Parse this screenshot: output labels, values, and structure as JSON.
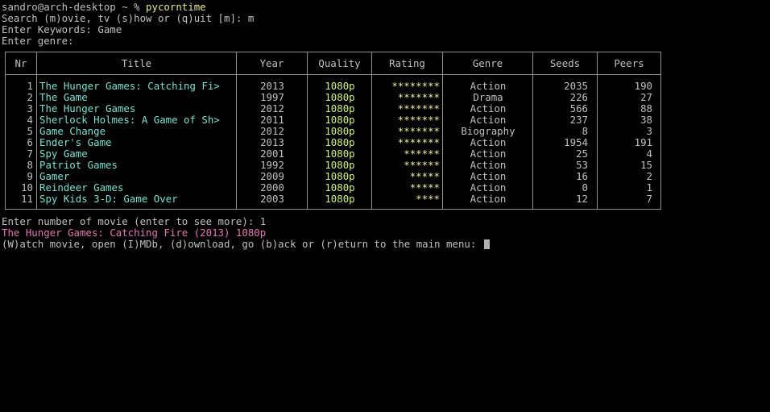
{
  "terminal": {
    "prompt_user_host": "sandro@arch-desktop ~ % ",
    "command": "pycorntime",
    "search_prompt": "Search (m)ovie, tv (s)how or (q)uit [m]: m",
    "keywords_prompt": "Enter Keywords: Game",
    "genre_prompt": "Enter genre:",
    "number_prompt": "Enter number of movie (enter to see more): 1",
    "selected_movie": "The Hunger Games: Catching Fire (2013) 1080p",
    "action_prompt": "(W)atch movie, open (I)MDb, (d)ownload, go (b)ack or (r)eturn to the main menu: "
  },
  "table": {
    "headers": {
      "nr": "Nr",
      "title": "Title",
      "year": "Year",
      "quality": "Quality",
      "rating": "Rating",
      "genre": "Genre",
      "seeds": "Seeds",
      "peers": "Peers"
    },
    "rows": [
      {
        "nr": "1",
        "title": "The Hunger Games: Catching Fi>",
        "year": "2013",
        "quality": "1080p",
        "rating": "********",
        "genre": "Action",
        "seeds": "2035",
        "peers": "190"
      },
      {
        "nr": "2",
        "title": "The Game",
        "year": "1997",
        "quality": "1080p",
        "rating": "*******",
        "genre": "Drama",
        "seeds": "226",
        "peers": "27"
      },
      {
        "nr": "3",
        "title": "The Hunger Games",
        "year": "2012",
        "quality": "1080p",
        "rating": "*******",
        "genre": "Action",
        "seeds": "566",
        "peers": "88"
      },
      {
        "nr": "4",
        "title": "Sherlock Holmes: A Game of Sh>",
        "year": "2011",
        "quality": "1080p",
        "rating": "*******",
        "genre": "Action",
        "seeds": "237",
        "peers": "38"
      },
      {
        "nr": "5",
        "title": "Game Change",
        "year": "2012",
        "quality": "1080p",
        "rating": "*******",
        "genre": "Biography",
        "seeds": "8",
        "peers": "3"
      },
      {
        "nr": "6",
        "title": "Ender's Game",
        "year": "2013",
        "quality": "1080p",
        "rating": "*******",
        "genre": "Action",
        "seeds": "1954",
        "peers": "191"
      },
      {
        "nr": "7",
        "title": "Spy Game",
        "year": "2001",
        "quality": "1080p",
        "rating": "******",
        "genre": "Action",
        "seeds": "25",
        "peers": "4"
      },
      {
        "nr": "8",
        "title": "Patriot Games",
        "year": "1992",
        "quality": "1080p",
        "rating": "******",
        "genre": "Action",
        "seeds": "53",
        "peers": "15"
      },
      {
        "nr": "9",
        "title": "Gamer",
        "year": "2009",
        "quality": "1080p",
        "rating": "*****",
        "genre": "Action",
        "seeds": "16",
        "peers": "2"
      },
      {
        "nr": "10",
        "title": "Reindeer Games",
        "year": "2000",
        "quality": "1080p",
        "rating": "*****",
        "genre": "Action",
        "seeds": "0",
        "peers": "1"
      },
      {
        "nr": "11",
        "title": "Spy Kids 3-D: Game Over",
        "year": "2003",
        "quality": "1080p",
        "rating": "****",
        "genre": "Action",
        "seeds": "12",
        "peers": "7"
      }
    ]
  },
  "colors": {
    "background": "#000000",
    "text": "#c0c0c0",
    "command": "#e8e890",
    "title": "#7fe0d0",
    "quality": "#d0f080",
    "rating": "#f0f0a0",
    "selection": "#e07ab0",
    "border": "#909090"
  }
}
